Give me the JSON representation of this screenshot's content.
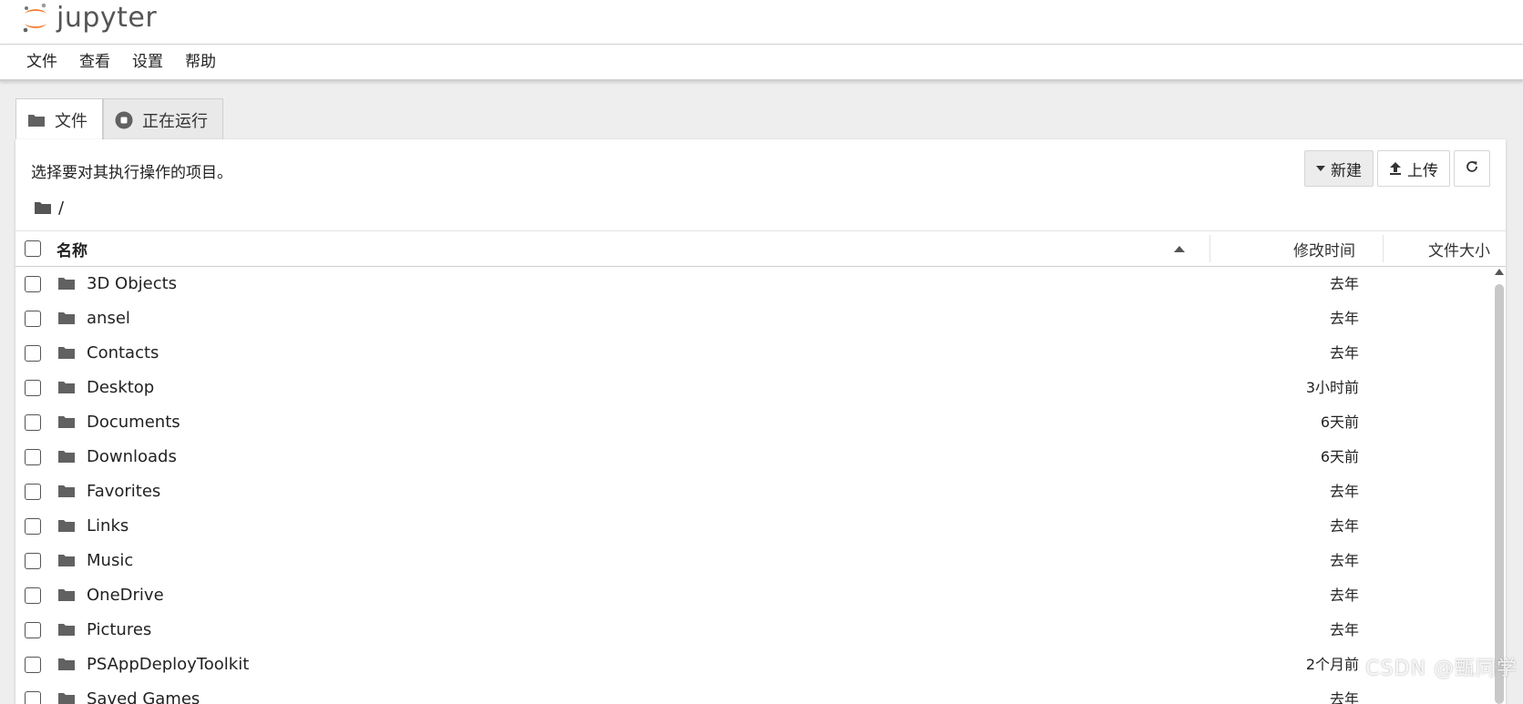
{
  "brand": {
    "name": "jupyter",
    "accent": "#F37726"
  },
  "menu": [
    "文件",
    "查看",
    "设置",
    "帮助"
  ],
  "tabs": [
    {
      "label": "文件",
      "icon": "folder-icon",
      "active": true
    },
    {
      "label": "正在运行",
      "icon": "stop-circle-icon",
      "active": false
    }
  ],
  "toolbar": {
    "hint": "选择要对其执行操作的项目。",
    "new_label": "新建",
    "upload_label": "上传",
    "refresh_icon": "refresh-icon"
  },
  "breadcrumb": {
    "path": "/"
  },
  "columns": {
    "name": "名称",
    "modified": "修改时间",
    "size": "文件大小",
    "sort": "ascending"
  },
  "files": [
    {
      "name": "3D Objects",
      "modified": "去年"
    },
    {
      "name": "ansel",
      "modified": "去年"
    },
    {
      "name": "Contacts",
      "modified": "去年"
    },
    {
      "name": "Desktop",
      "modified": "3小时前"
    },
    {
      "name": "Documents",
      "modified": "6天前"
    },
    {
      "name": "Downloads",
      "modified": "6天前"
    },
    {
      "name": "Favorites",
      "modified": "去年"
    },
    {
      "name": "Links",
      "modified": "去年"
    },
    {
      "name": "Music",
      "modified": "去年"
    },
    {
      "name": "OneDrive",
      "modified": "去年"
    },
    {
      "name": "Pictures",
      "modified": "去年"
    },
    {
      "name": "PSAppDeployToolkit",
      "modified": "2个月前"
    },
    {
      "name": "Saved Games",
      "modified": "去年"
    }
  ],
  "watermark": "CSDN @甄同学"
}
